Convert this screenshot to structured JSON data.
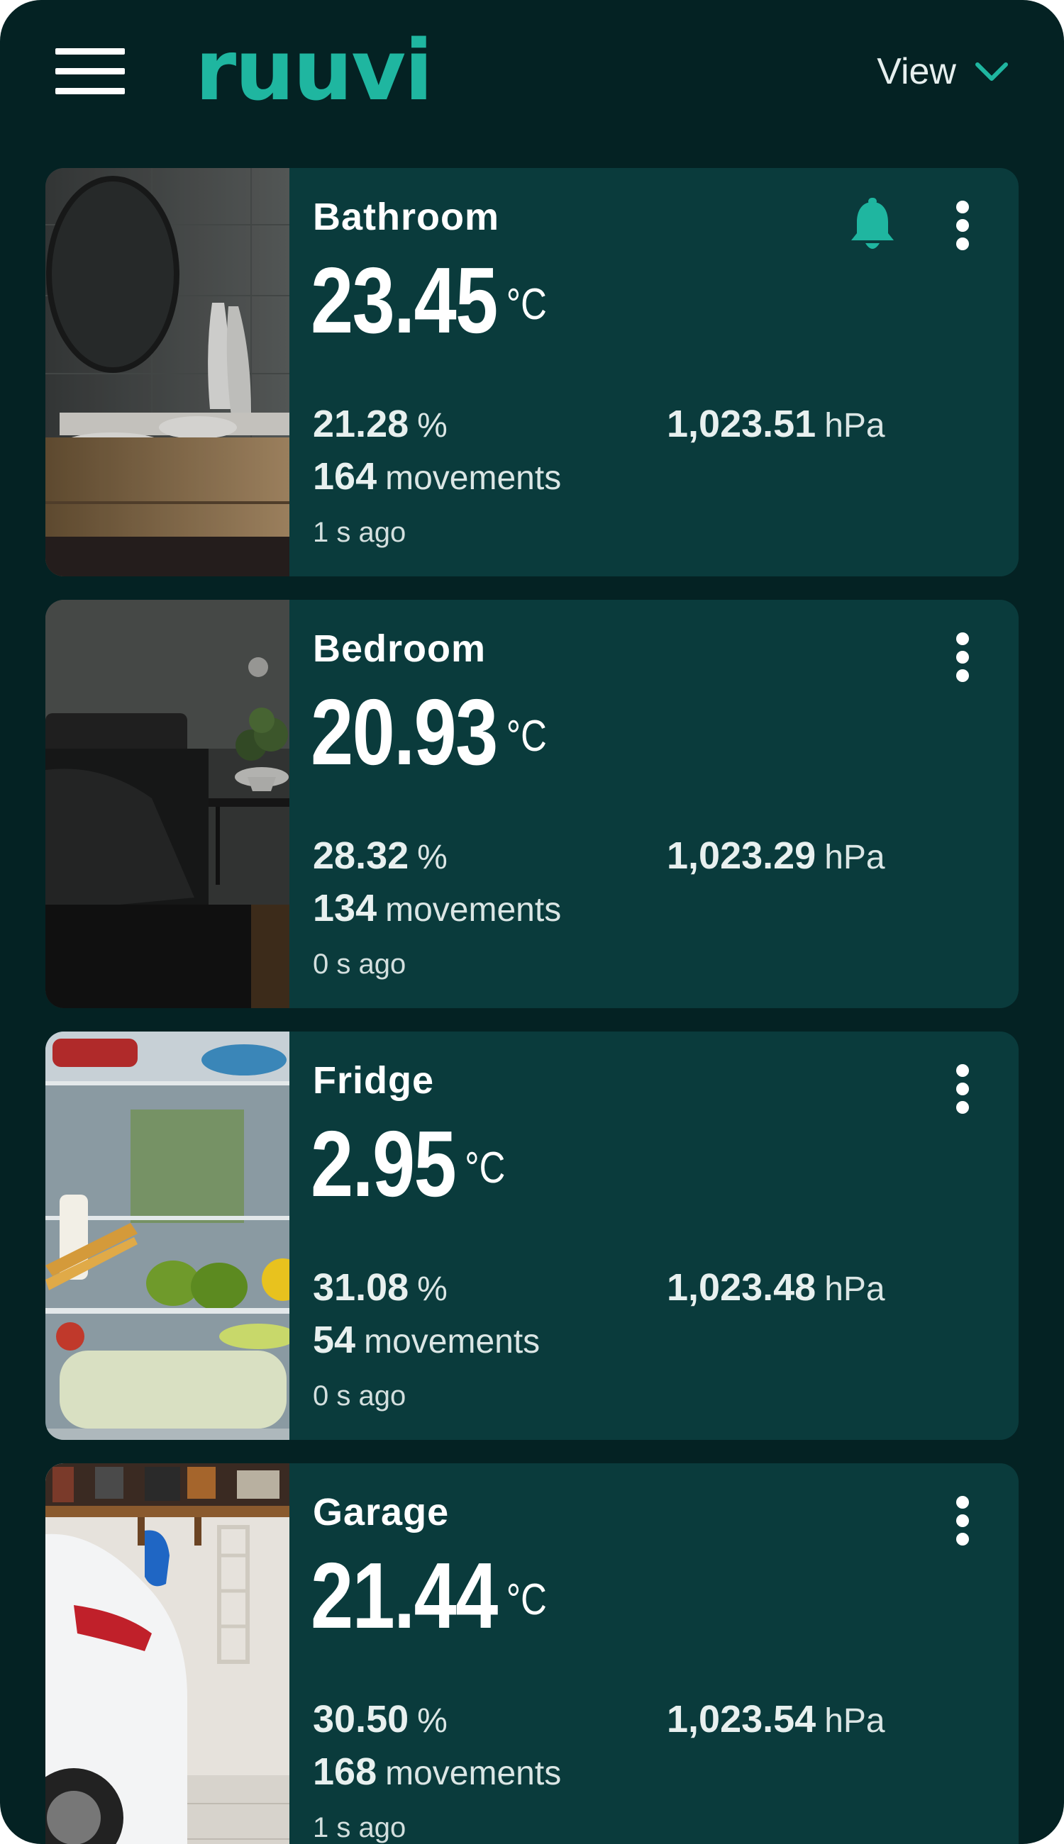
{
  "header": {
    "logo_text": "ruuvi",
    "view_label": "View",
    "menu_icon": "hamburger-menu-icon",
    "view_icon": "chevron-down-icon"
  },
  "colors": {
    "background": "#042223",
    "card": "#0a3b3c",
    "accent": "#1fb6a0"
  },
  "sensors": [
    {
      "name": "Bathroom",
      "temperature": "23.45",
      "temp_unit": "°C",
      "humidity": "21.28",
      "humidity_unit": "%",
      "pressure": "1,023.51",
      "pressure_unit": "hPa",
      "movements": "164",
      "movements_label": "movements",
      "updated": "1 s ago",
      "has_alert": true,
      "photo": "bathroom-photo"
    },
    {
      "name": "Bedroom",
      "temperature": "20.93",
      "temp_unit": "°C",
      "humidity": "28.32",
      "humidity_unit": "%",
      "pressure": "1,023.29",
      "pressure_unit": "hPa",
      "movements": "134",
      "movements_label": "movements",
      "updated": "0 s ago",
      "has_alert": false,
      "photo": "bedroom-photo"
    },
    {
      "name": "Fridge",
      "temperature": "2.95",
      "temp_unit": "°C",
      "humidity": "31.08",
      "humidity_unit": "%",
      "pressure": "1,023.48",
      "pressure_unit": "hPa",
      "movements": "54",
      "movements_label": "movements",
      "updated": "0 s ago",
      "has_alert": false,
      "photo": "fridge-photo"
    },
    {
      "name": "Garage",
      "temperature": "21.44",
      "temp_unit": "°C",
      "humidity": "30.50",
      "humidity_unit": "%",
      "pressure": "1,023.54",
      "pressure_unit": "hPa",
      "movements": "168",
      "movements_label": "movements",
      "updated": "1 s ago",
      "has_alert": false,
      "photo": "garage-photo"
    }
  ]
}
